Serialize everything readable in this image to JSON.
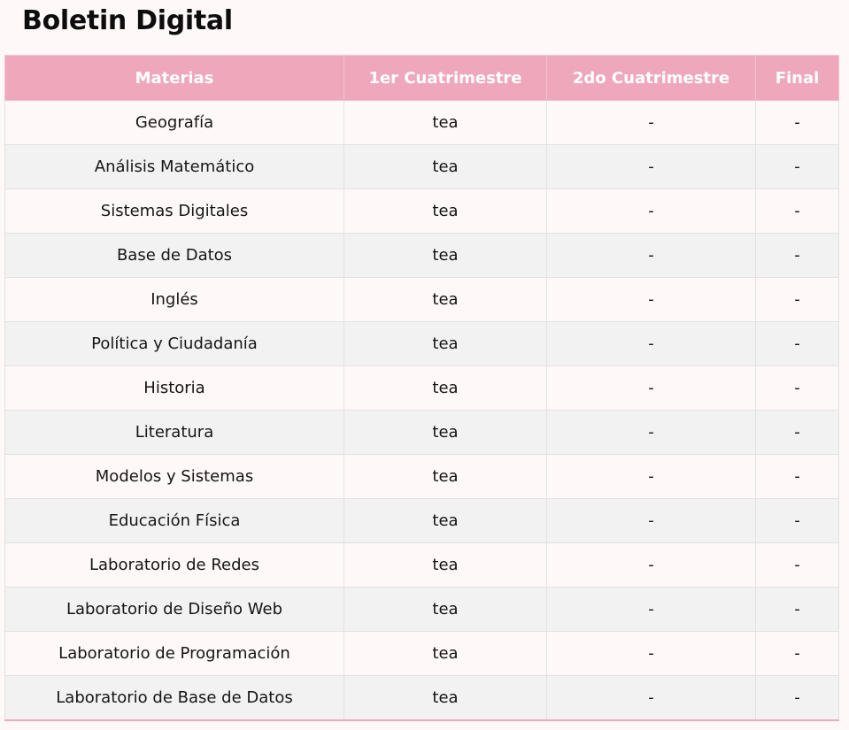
{
  "page": {
    "title": "Boletin Digital"
  },
  "colors": {
    "header_background": "#efa8bb",
    "header_text": "#ffffff",
    "row_light": "#fff8f8",
    "row_alt": "#f2f2f2",
    "page_background": "#fff8f8"
  },
  "table": {
    "columns": [
      "Materias",
      "1er Cuatrimestre",
      "2do Cuatrimestre",
      "Final"
    ],
    "rows": [
      [
        "Geografía",
        "tea",
        "-",
        "-"
      ],
      [
        "Análisis Matemático",
        "tea",
        "-",
        "-"
      ],
      [
        "Sistemas Digitales",
        "tea",
        "-",
        "-"
      ],
      [
        "Base de Datos",
        "tea",
        "-",
        "-"
      ],
      [
        "Inglés",
        "tea",
        "-",
        "-"
      ],
      [
        "Política y Ciudadanía",
        "tea",
        "-",
        "-"
      ],
      [
        "Historia",
        "tea",
        "-",
        "-"
      ],
      [
        "Literatura",
        "tea",
        "-",
        "-"
      ],
      [
        "Modelos y Sistemas",
        "tea",
        "-",
        "-"
      ],
      [
        "Educación Física",
        "tea",
        "-",
        "-"
      ],
      [
        "Laboratorio de Redes",
        "tea",
        "-",
        "-"
      ],
      [
        "Laboratorio de Diseño Web",
        "tea",
        "-",
        "-"
      ],
      [
        "Laboratorio de Programación",
        "tea",
        "-",
        "-"
      ],
      [
        "Laboratorio de Base de Datos",
        "tea",
        "-",
        "-"
      ]
    ]
  }
}
